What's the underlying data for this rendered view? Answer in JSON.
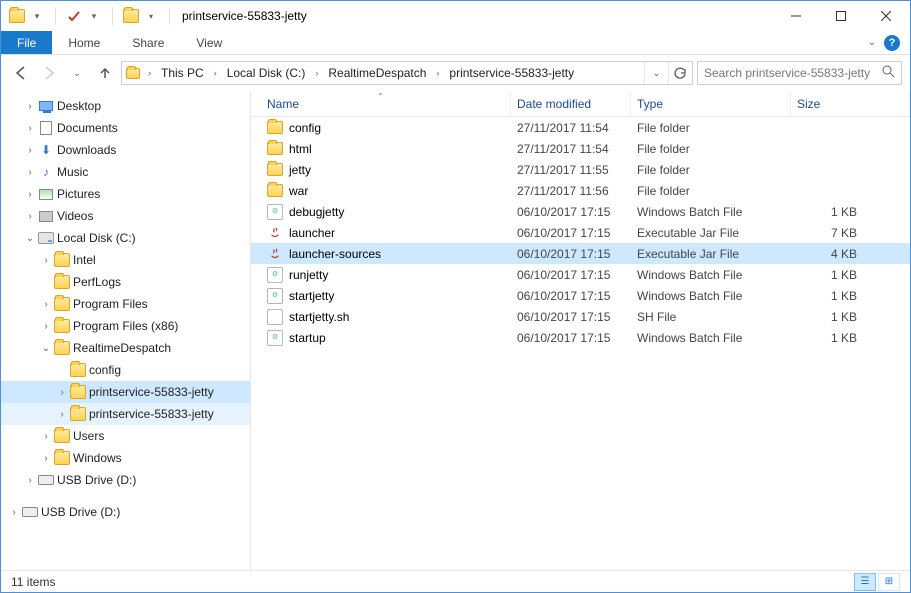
{
  "window": {
    "title": "printservice-55833-jetty"
  },
  "ribbon": {
    "file": "File",
    "tabs": [
      "Home",
      "Share",
      "View"
    ]
  },
  "breadcrumb": {
    "segments": [
      "This PC",
      "Local Disk (C:)",
      "RealtimeDespatch",
      "printservice-55833-jetty"
    ]
  },
  "search": {
    "placeholder": "Search printservice-55833-jetty"
  },
  "columns": {
    "name": "Name",
    "date": "Date modified",
    "type": "Type",
    "size": "Size"
  },
  "tree": [
    {
      "label": "Desktop",
      "icon": "desktop",
      "depth": 1,
      "exp": ">"
    },
    {
      "label": "Documents",
      "icon": "doc",
      "depth": 1,
      "exp": ">"
    },
    {
      "label": "Downloads",
      "icon": "down",
      "depth": 1,
      "exp": ">"
    },
    {
      "label": "Music",
      "icon": "music",
      "depth": 1,
      "exp": ">"
    },
    {
      "label": "Pictures",
      "icon": "pic",
      "depth": 1,
      "exp": ">"
    },
    {
      "label": "Videos",
      "icon": "vid",
      "depth": 1,
      "exp": ">"
    },
    {
      "label": "Local Disk (C:)",
      "icon": "drive",
      "depth": 1,
      "exp": "v"
    },
    {
      "label": "Intel",
      "icon": "folder",
      "depth": 2,
      "exp": ">"
    },
    {
      "label": "PerfLogs",
      "icon": "folder",
      "depth": 2,
      "exp": ""
    },
    {
      "label": "Program Files",
      "icon": "folder",
      "depth": 2,
      "exp": ">"
    },
    {
      "label": "Program Files (x86)",
      "icon": "folder",
      "depth": 2,
      "exp": ">"
    },
    {
      "label": "RealtimeDespatch",
      "icon": "folder",
      "depth": 2,
      "exp": "v"
    },
    {
      "label": "config",
      "icon": "folder",
      "depth": 3,
      "exp": ""
    },
    {
      "label": "printservice-55833-jetty",
      "icon": "folder",
      "depth": 3,
      "exp": ">",
      "selected": true
    },
    {
      "label": "printservice-55833-jetty",
      "icon": "folder",
      "depth": 3,
      "exp": ">",
      "hover": true
    },
    {
      "label": "Users",
      "icon": "folder",
      "depth": 2,
      "exp": ">"
    },
    {
      "label": "Windows",
      "icon": "folder",
      "depth": 2,
      "exp": ">"
    },
    {
      "label": "USB Drive (D:)",
      "icon": "usb",
      "depth": 1,
      "exp": ">"
    },
    {
      "label": "",
      "icon": "spacer",
      "depth": 0,
      "exp": ""
    },
    {
      "label": "USB Drive (D:)",
      "icon": "usb",
      "depth": 0,
      "exp": ">"
    }
  ],
  "files": [
    {
      "name": "config",
      "date": "27/11/2017 11:54",
      "type": "File folder",
      "size": "",
      "icon": "folder"
    },
    {
      "name": "html",
      "date": "27/11/2017 11:54",
      "type": "File folder",
      "size": "",
      "icon": "folder"
    },
    {
      "name": "jetty",
      "date": "27/11/2017 11:55",
      "type": "File folder",
      "size": "",
      "icon": "folder"
    },
    {
      "name": "war",
      "date": "27/11/2017 11:56",
      "type": "File folder",
      "size": "",
      "icon": "folder"
    },
    {
      "name": "debugjetty",
      "date": "06/10/2017 17:15",
      "type": "Windows Batch File",
      "size": "1 KB",
      "icon": "bat"
    },
    {
      "name": "launcher",
      "date": "06/10/2017 17:15",
      "type": "Executable Jar File",
      "size": "7 KB",
      "icon": "jar"
    },
    {
      "name": "launcher-sources",
      "date": "06/10/2017 17:15",
      "type": "Executable Jar File",
      "size": "4 KB",
      "icon": "jar",
      "selected": true
    },
    {
      "name": "runjetty",
      "date": "06/10/2017 17:15",
      "type": "Windows Batch File",
      "size": "1 KB",
      "icon": "bat"
    },
    {
      "name": "startjetty",
      "date": "06/10/2017 17:15",
      "type": "Windows Batch File",
      "size": "1 KB",
      "icon": "bat"
    },
    {
      "name": "startjetty.sh",
      "date": "06/10/2017 17:15",
      "type": "SH File",
      "size": "1 KB",
      "icon": "file"
    },
    {
      "name": "startup",
      "date": "06/10/2017 17:15",
      "type": "Windows Batch File",
      "size": "1 KB",
      "icon": "bat"
    }
  ],
  "status": {
    "count": "11 items"
  }
}
